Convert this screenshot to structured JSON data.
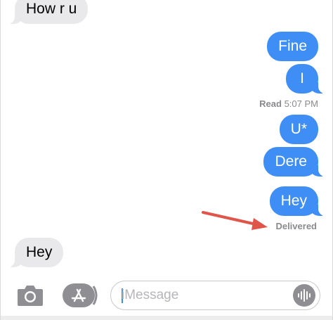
{
  "messages": {
    "m1": "How r u",
    "m2": "Fine",
    "m3": "I",
    "m4": "U*",
    "m5": "Dere",
    "m6": "Hey",
    "m7": "Hey"
  },
  "receipts": {
    "read_label": "Read",
    "read_time": "5:07 PM",
    "delivered": "Delivered"
  },
  "composer": {
    "placeholder": "iMessage"
  },
  "icons": {
    "camera": "camera-icon",
    "app_store": "app-store-icon",
    "audio": "audio-waveform-icon",
    "arrow": "annotation-arrow"
  },
  "colors": {
    "outgoing": "#3e8ef5",
    "incoming": "#e9e9eb",
    "arrow": "#e0554a"
  }
}
